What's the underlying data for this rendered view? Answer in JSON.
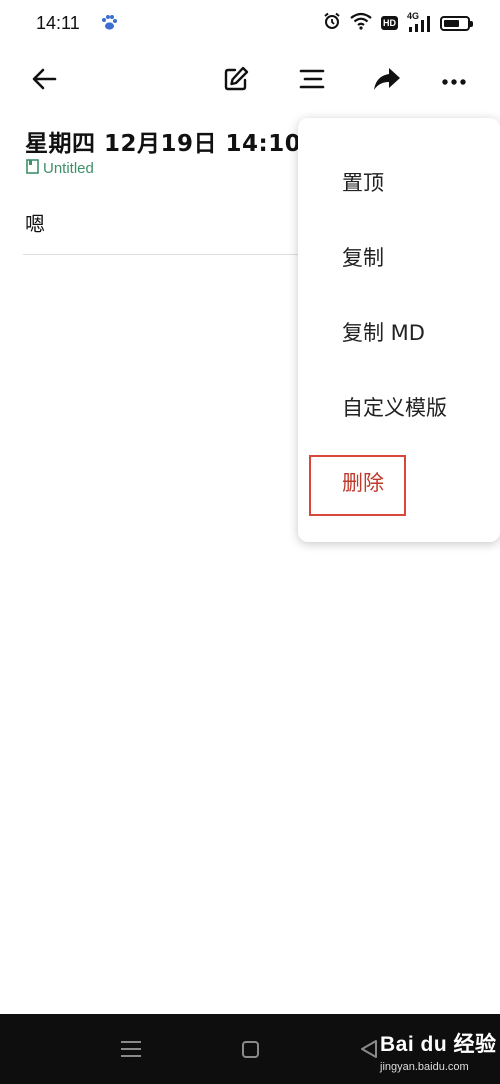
{
  "status_bar": {
    "time": "14:11",
    "network_label": "4G",
    "hd_label": "HD",
    "battery_level": 0.7,
    "icons": [
      "baidu-paw-icon",
      "alarm-icon",
      "wifi-icon",
      "hd-icon",
      "signal-icon",
      "battery-icon"
    ]
  },
  "toolbar": {
    "icons": [
      "back-arrow-icon",
      "edit-icon",
      "outline-icon",
      "share-icon",
      "more-icon"
    ]
  },
  "note": {
    "title": "星期四 12月19日 14:10",
    "notebook": "Untitled",
    "body": "嗯"
  },
  "menu": {
    "items": [
      {
        "label": "置顶"
      },
      {
        "label": "复制"
      },
      {
        "label": "复制 MD"
      },
      {
        "label": "自定义模版"
      },
      {
        "label": "删除",
        "destructive": true
      }
    ]
  },
  "watermark": {
    "brand": "Bai du 经验",
    "site": "jingyan.baidu.com"
  },
  "colors": {
    "accent_green": "#3f8f6b",
    "danger_red": "#c0392b",
    "highlight_box": "#d9473c",
    "nav_bar_bg": "#0e0e0e"
  }
}
